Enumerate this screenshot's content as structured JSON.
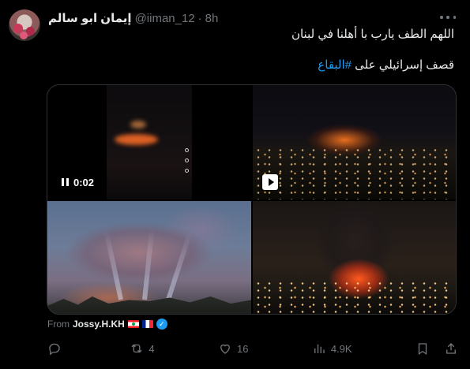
{
  "tweet": {
    "display_name": "إيمان ابو سالم",
    "handle": "@iiman_12",
    "separator": "·",
    "time": "8h",
    "text_line1": "اللهم الطف يارب با أهلنا في لبنان",
    "text_line2_prefix": "قصف إسرائيلي على ",
    "hashtag": "#البقاع"
  },
  "media": {
    "video_timer": "0:02",
    "icons": {
      "pause": "pause-icon",
      "play": "play-icon"
    }
  },
  "attribution": {
    "from_label": "From",
    "source_name": "Jossy.H.KH",
    "flags": [
      "lebanon-flag",
      "france-flag"
    ],
    "verified": true
  },
  "actions": {
    "replies": "",
    "reposts": "4",
    "likes": "16",
    "views": "4.9K"
  },
  "colors": {
    "background": "#000000",
    "text": "#e7e9ea",
    "muted": "#71767b",
    "accent": "#1d9bf0"
  }
}
